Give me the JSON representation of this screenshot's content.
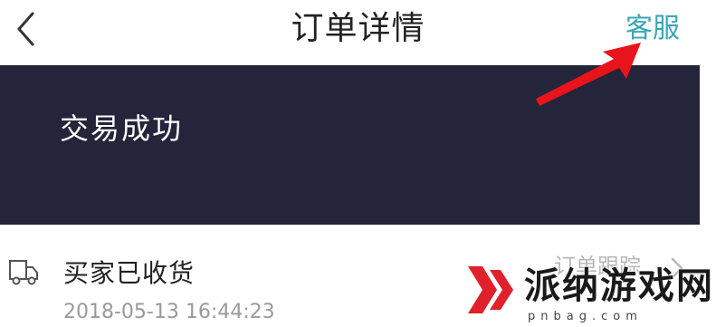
{
  "header": {
    "back_icon": "chevron-left-icon",
    "title": "订单详情",
    "service_label": "客服",
    "accent_color": "#3aa6b5"
  },
  "annotation": {
    "arrow_color": "#e8141c",
    "arrow_icon": "red-arrow-icon"
  },
  "status_banner": {
    "status": "交易成功",
    "background": "#24243a"
  },
  "logistics": {
    "icon": "truck-icon",
    "status": "买家已收货",
    "time": "2018-05-13 16:44:23",
    "track_label": "订单跟踪",
    "chevron_icon": "chevron-right-icon"
  },
  "watermark": {
    "text": "派纳游戏网",
    "url": "pnbag.com",
    "logo_icon": "watermark-logo-icon"
  }
}
